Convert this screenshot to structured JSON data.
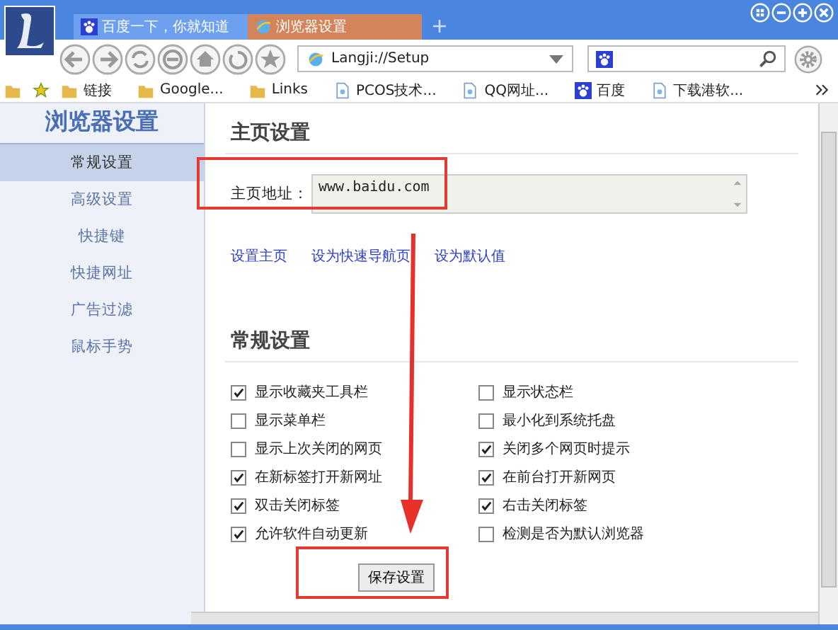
{
  "tabs": [
    {
      "label": "百度一下，你就知道",
      "selected": false,
      "kind": "paw"
    },
    {
      "label": "浏览器设置",
      "selected": true,
      "kind": "ie"
    }
  ],
  "address": {
    "value": "Langji://Setup"
  },
  "bookmarks": [
    {
      "label": "链接",
      "kind": "folder"
    },
    {
      "label": "Google...",
      "kind": "folder"
    },
    {
      "label": "Links",
      "kind": "folder"
    },
    {
      "label": "PCOS技术...",
      "kind": "page"
    },
    {
      "label": "QQ网址...",
      "kind": "page"
    },
    {
      "label": "百度",
      "kind": "paw"
    },
    {
      "label": "下载港软...",
      "kind": "page"
    }
  ],
  "sidebar": {
    "title": "浏览器设置",
    "items": [
      {
        "label": "常规设置",
        "selected": true
      },
      {
        "label": "高级设置",
        "selected": false
      },
      {
        "label": "快捷键",
        "selected": false
      },
      {
        "label": "快捷网址",
        "selected": false
      },
      {
        "label": "广告过滤",
        "selected": false
      },
      {
        "label": "鼠标手势",
        "selected": false
      }
    ]
  },
  "homepage": {
    "heading": "主页设置",
    "label": "主页地址：",
    "value": "www.baidu.com",
    "links": [
      "设置主页",
      "设为快速导航页",
      "设为默认值"
    ]
  },
  "general": {
    "heading": "常规设置",
    "options": [
      {
        "label": "显示收藏夹工具栏",
        "checked": true
      },
      {
        "label": "显示状态栏",
        "checked": false
      },
      {
        "label": "显示菜单栏",
        "checked": false
      },
      {
        "label": "最小化到系统托盘",
        "checked": false
      },
      {
        "label": "显示上次关闭的网页",
        "checked": false
      },
      {
        "label": "关闭多个网页时提示",
        "checked": true
      },
      {
        "label": "在新标签打开新网址",
        "checked": true
      },
      {
        "label": "在前台打开新网页",
        "checked": true
      },
      {
        "label": "双击关闭标签",
        "checked": true
      },
      {
        "label": "右击关闭标签",
        "checked": true
      },
      {
        "label": "允许软件自动更新",
        "checked": true
      },
      {
        "label": "检测是否为默认浏览器",
        "checked": false
      }
    ]
  },
  "save_button": "保存设置"
}
